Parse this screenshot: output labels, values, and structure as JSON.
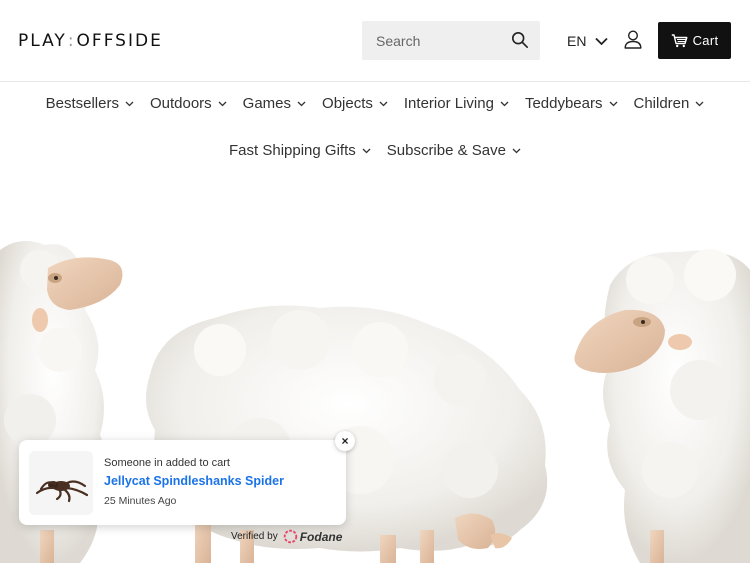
{
  "header": {
    "logo_left": "PLAY",
    "logo_sep": ":",
    "logo_right": "OFFSIDE",
    "search": {
      "placeholder": "Search"
    },
    "language": "EN",
    "cart_label": "Cart"
  },
  "nav": {
    "row1": [
      {
        "label": "Bestsellers"
      },
      {
        "label": "Outdoors"
      },
      {
        "label": "Games"
      },
      {
        "label": "Objects"
      },
      {
        "label": "Interior Living"
      },
      {
        "label": "Teddybears"
      },
      {
        "label": "Children"
      }
    ],
    "row2": [
      {
        "label": "Fast Shipping Gifts"
      },
      {
        "label": "Subscribe & Save"
      }
    ]
  },
  "popup": {
    "line1": "Someone in added to cart",
    "product": "Jellycat Spindleshanks Spider",
    "time": "25 Minutes Ago",
    "close": "×",
    "verified_prefix": "Verified by",
    "verified_brand": "Fodane"
  },
  "icons": [
    "search-icon",
    "chevron-down-icon",
    "user-icon",
    "cart-icon",
    "close-icon",
    "fodane-logo-icon"
  ]
}
